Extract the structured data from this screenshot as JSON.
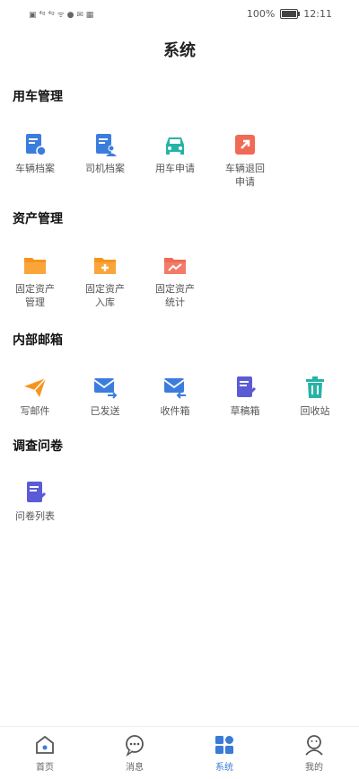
{
  "status": {
    "battery": "100%",
    "time": "12:11"
  },
  "header": {
    "title": "系统"
  },
  "sections": [
    {
      "title": "用车管理",
      "items": [
        {
          "label": "车辆档案",
          "icon": "vehicle-file-icon"
        },
        {
          "label": "司机档案",
          "icon": "driver-file-icon"
        },
        {
          "label": "用车申请",
          "icon": "car-icon"
        },
        {
          "label": "车辆退回申请",
          "label1": "车辆退回",
          "label2": "申请",
          "icon": "vehicle-return-icon"
        }
      ]
    },
    {
      "title": "资产管理",
      "items": [
        {
          "label1": "固定资产",
          "label2": "管理",
          "icon": "folder-icon"
        },
        {
          "label1": "固定资产",
          "label2": "入库",
          "icon": "folder-add-icon"
        },
        {
          "label1": "固定资产",
          "label2": "统计",
          "icon": "folder-chart-icon"
        }
      ]
    },
    {
      "title": "内部邮箱",
      "items": [
        {
          "label": "写邮件",
          "icon": "paper-plane-icon"
        },
        {
          "label": "已发送",
          "icon": "mail-sent-icon"
        },
        {
          "label": "收件箱",
          "icon": "mail-inbox-icon"
        },
        {
          "label": "草稿箱",
          "icon": "draft-icon"
        },
        {
          "label": "回收站",
          "icon": "trash-icon"
        }
      ]
    },
    {
      "title": "调查问卷",
      "items": [
        {
          "label": "问卷列表",
          "icon": "survey-list-icon"
        }
      ]
    }
  ],
  "tabs": [
    {
      "label": "首页",
      "icon": "home-icon"
    },
    {
      "label": "消息",
      "icon": "message-icon"
    },
    {
      "label": "系统",
      "icon": "grid-icon",
      "active": true
    },
    {
      "label": "我的",
      "icon": "profile-icon"
    }
  ],
  "colors": {
    "blue": "#3b7ddd",
    "teal": "#26b3a6",
    "red": "#f06a55",
    "orange": "#f7941d",
    "purple": "#5b5bd6",
    "active_tab": "#3a7bd5"
  }
}
